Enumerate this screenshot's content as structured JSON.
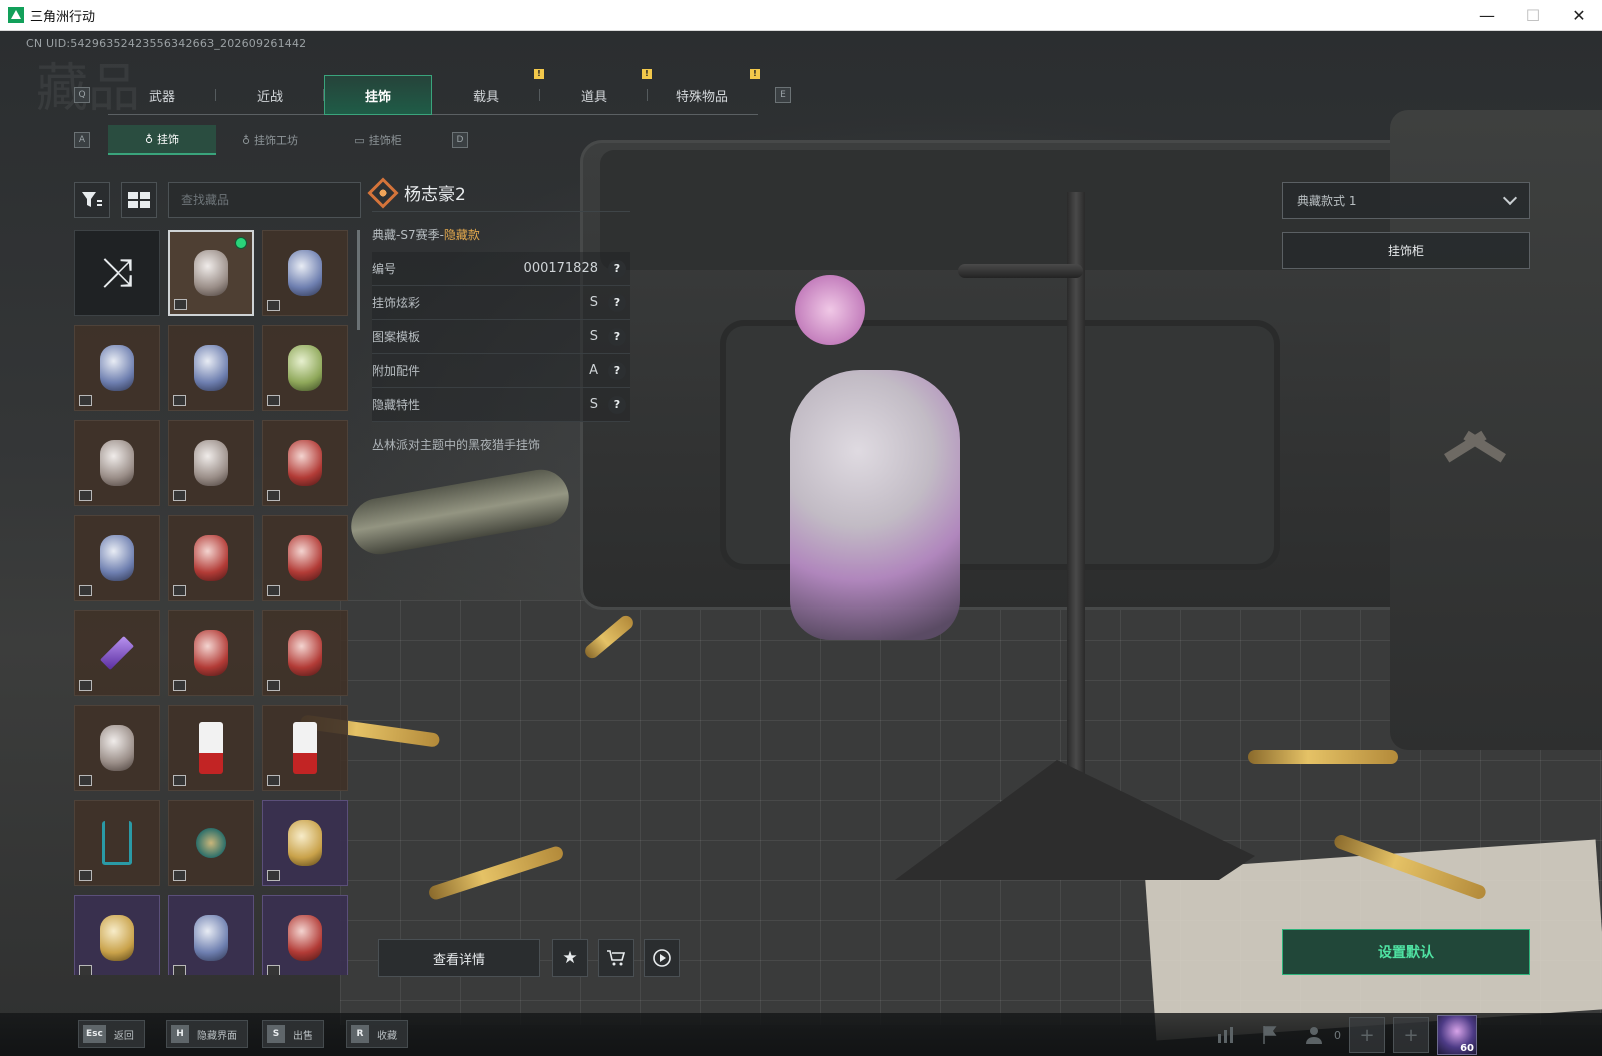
{
  "window": {
    "title": "三角洲行动",
    "controls": {
      "minimize": "—",
      "maximize": "☐",
      "close": "✕"
    }
  },
  "uid": "CN UID:5429635242355634266З_202609261442",
  "watermark": "藏品",
  "main_tabs": {
    "prev_key": "Q",
    "next_key": "E",
    "items": [
      {
        "label": "武器",
        "active": false,
        "notification": ""
      },
      {
        "label": "近战",
        "active": false,
        "notification": ""
      },
      {
        "label": "挂饰",
        "active": true,
        "notification": ""
      },
      {
        "label": "载具",
        "active": false,
        "notification": "!"
      },
      {
        "label": "道具",
        "active": false,
        "notification": "!"
      },
      {
        "label": "特殊物品",
        "active": false,
        "notification": "!"
      }
    ]
  },
  "sub_tabs": {
    "prev_key": "A",
    "next_key": "D",
    "items": [
      {
        "label": "挂饰",
        "icon": "charm-icon",
        "active": true
      },
      {
        "label": "挂饰工坊",
        "icon": "charm-icon",
        "active": false
      },
      {
        "label": "挂饰柜",
        "icon": "cabinet-icon",
        "active": false
      }
    ]
  },
  "inventory": {
    "search_placeholder": "查找藏品",
    "random_icon": "shuffle-icon",
    "items": [
      {
        "variant": "random"
      },
      {
        "variant": "selected",
        "charm": "white",
        "equipped": true
      },
      {
        "variant": "",
        "charm": "blue"
      },
      {
        "variant": "",
        "charm": "blue"
      },
      {
        "variant": "",
        "charm": "blue"
      },
      {
        "variant": "",
        "charm": "green"
      },
      {
        "variant": "",
        "charm": "white"
      },
      {
        "variant": "",
        "charm": "white"
      },
      {
        "variant": "",
        "charm": "red"
      },
      {
        "variant": "",
        "charm": "blue"
      },
      {
        "variant": "",
        "charm": "red"
      },
      {
        "variant": "",
        "charm": "red"
      },
      {
        "variant": "",
        "charm": "violet"
      },
      {
        "variant": "",
        "charm": "red"
      },
      {
        "variant": "",
        "charm": "red"
      },
      {
        "variant": "",
        "charm": "white"
      },
      {
        "variant": "",
        "charm": "tag"
      },
      {
        "variant": "",
        "charm": "tag"
      },
      {
        "variant": "",
        "charm": "anchor"
      },
      {
        "variant": "",
        "charm": "ring"
      },
      {
        "variant": "purple",
        "charm": "gold"
      },
      {
        "variant": "purple",
        "charm": "gold"
      },
      {
        "variant": "purple",
        "charm": "blue"
      },
      {
        "variant": "purple",
        "charm": "red"
      }
    ]
  },
  "detail": {
    "name": "杨志豪2",
    "season_prefix": "典藏-S7赛季-",
    "season_hidden": "隐藏款",
    "props": [
      {
        "label": "编号",
        "value": "000171828"
      },
      {
        "label": "挂饰炫彩",
        "value": "S"
      },
      {
        "label": "图案模板",
        "value": "S"
      },
      {
        "label": "附加配件",
        "value": "A"
      },
      {
        "label": "隐藏特性",
        "value": "S"
      }
    ],
    "help": "?",
    "description": "丛林派对主题中的黑夜猎手挂饰"
  },
  "right_panel": {
    "style_select": "典藏款式 1",
    "cabinet_button": "挂饰柜"
  },
  "actions": {
    "view_details": "查看详情",
    "favorite_icon": "★",
    "cart_icon": "🛒",
    "play_icon": "▶",
    "set_default": "设置默认"
  },
  "hints": [
    {
      "key": "Esc",
      "label": "返回"
    },
    {
      "key": "H",
      "label": "隐藏界面"
    },
    {
      "key": "S",
      "label": "出售"
    },
    {
      "key": "R",
      "label": "收藏"
    }
  ],
  "status": {
    "friends_count": "0",
    "level": "60"
  },
  "colors": {
    "accent_green": "#2fb47c",
    "hidden_orange": "#e4a94d",
    "notification_yellow": "#f2c84b"
  }
}
